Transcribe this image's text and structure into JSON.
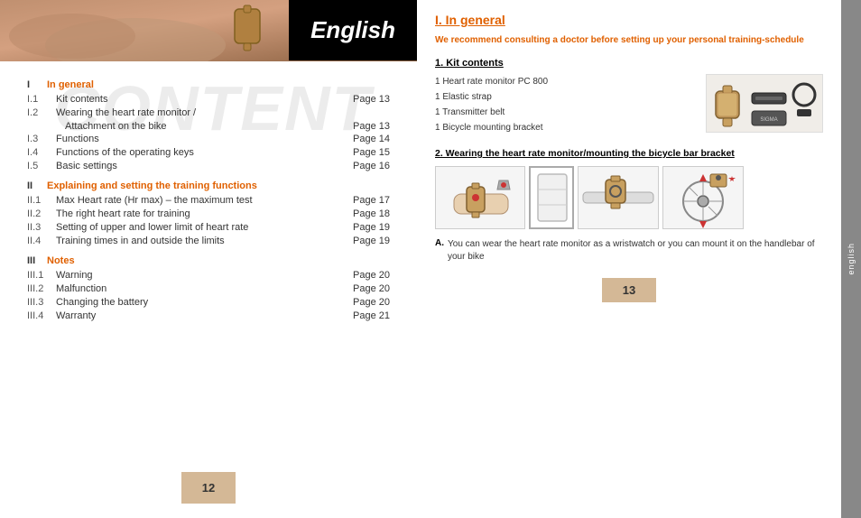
{
  "leftPage": {
    "heroTitle": "English",
    "watermark": "CONTENT",
    "pageNumber": "12",
    "toc": {
      "sections": [
        {
          "num": "I",
          "title": "In general",
          "items": [
            {
              "num": "I.1",
              "label": "Kit contents",
              "page": "Page 13"
            },
            {
              "num": "I.2",
              "label": "Wearing the heart rate monitor /",
              "labelSub": "Attachment on the bike",
              "page": "Page 13"
            },
            {
              "num": "I.3",
              "label": "Functions",
              "page": "Page 14"
            },
            {
              "num": "I.4",
              "label": "Functions of the operating keys",
              "page": "Page 15"
            },
            {
              "num": "I.5",
              "label": "Basic settings",
              "page": "Page 16"
            }
          ]
        },
        {
          "num": "II",
          "title": "Explaining and setting the training functions",
          "items": [
            {
              "num": "II.1",
              "label": "Max Heart rate (Hr max) – the maximum test",
              "page": "Page 17"
            },
            {
              "num": "II.2",
              "label": "The right heart rate for training",
              "page": "Page 18"
            },
            {
              "num": "II.3",
              "label": "Setting of upper and lower limit of heart rate",
              "page": "Page 19"
            },
            {
              "num": "II.4",
              "label": "Training times in and outside the limits",
              "page": "Page 19"
            }
          ]
        },
        {
          "num": "III",
          "title": "Notes",
          "items": [
            {
              "num": "III.1",
              "label": "Warning",
              "page": "Page 20"
            },
            {
              "num": "III.2",
              "label": "Malfunction",
              "page": "Page 20"
            },
            {
              "num": "III.3",
              "label": "Changing the battery",
              "page": "Page 20"
            },
            {
              "num": "III.4",
              "label": "Warranty",
              "page": "Page 21"
            }
          ]
        }
      ]
    }
  },
  "rightPage": {
    "pageNumber": "13",
    "sidebarLabel": "english",
    "mainTitle": "I.  In general",
    "introText": "We recommend consulting a doctor before setting up your personal training-schedule",
    "section1": {
      "title": "1.  Kit contents",
      "items": [
        "1  Heart rate monitor PC 800",
        "1  Elastic strap",
        "1  Transmitter belt",
        "1  Bicycle mounting bracket"
      ]
    },
    "section2": {
      "title": "2.  Wearing the heart rate monitor/mounting the bicycle bar bracket"
    },
    "noteA": {
      "label": "A.",
      "text": "You can wear the heart rate monitor as a wristwatch or you can mount it on the handlebar of your bike"
    }
  }
}
